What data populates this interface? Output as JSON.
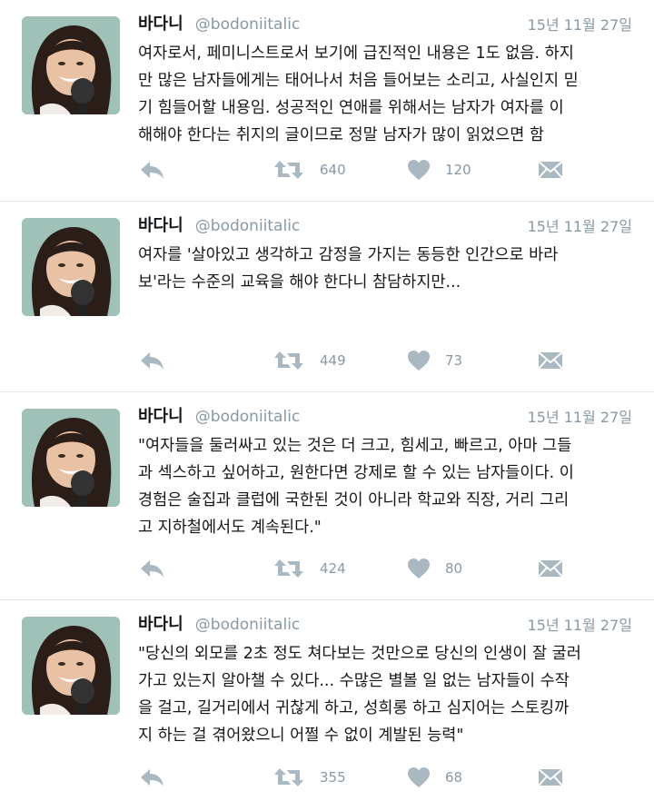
{
  "tweets": [
    {
      "name": "바다니",
      "handle": "@bodoniitalic",
      "date": "15년 11월 27일",
      "text": "여자로서, 페미니스트로서 보기에 급진적인 내용은 1도 없음. 하지\n만 많은 남자들에게는 태어나서 처음 들어보는 소리고, 사실인지 믿\n기 힘들어할 내용임. 성공적인 연애를 위해서는 남자가 여자를 이\n해해야 한다는 취지의 글이므로 정말 남자가 많이 읽었으면 함",
      "retweets": "640",
      "likes": "120"
    },
    {
      "name": "바다니",
      "handle": "@bodoniitalic",
      "date": "15년 11월 27일",
      "text": "여자를 '살아있고 생각하고 감정을 가지는 동등한 인간으로 바라\n보'라는 수준의 교육을 해야 한다니 참담하지만...",
      "retweets": "449",
      "likes": "73"
    },
    {
      "name": "바다니",
      "handle": "@bodoniitalic",
      "date": "15년 11월 27일",
      "text": "\"여자들을 둘러싸고 있는 것은 더 크고, 힘세고, 빠르고, 아마 그들\n과 섹스하고 싶어하고, 원한다면 강제로 할 수 있는 남자들이다. 이\n경험은 술집과 클럽에 국한된 것이 아니라 학교와 직장, 거리 그리\n고 지하철에서도 계속된다.\"",
      "retweets": "424",
      "likes": "80"
    },
    {
      "name": "바다니",
      "handle": "@bodoniitalic",
      "date": "15년 11월 27일",
      "text": "\"당신의 외모를 2초 정도 쳐다보는 것만으로 당신의 인생이 잘 굴러\n가고 있는지 알아챌 수 있다... 수많은 별볼 일 없는 남자들이 수작\n을 걸고, 길거리에서 귀찮게 하고, 성희롱 하고 심지어는 스토킹까\n지 하는 걸 겪어왔으니 어쩔 수 없이 계발된 능력\"",
      "retweets": "355",
      "likes": "68"
    }
  ],
  "icons": {
    "reply": "reply-icon",
    "retweet": "retweet-icon",
    "like": "heart-icon",
    "message": "direct-message-icon"
  },
  "colors": {
    "icon": "#aab8c2",
    "muted": "#8899a6",
    "text": "#14171a",
    "divider": "#e1e8ed"
  }
}
